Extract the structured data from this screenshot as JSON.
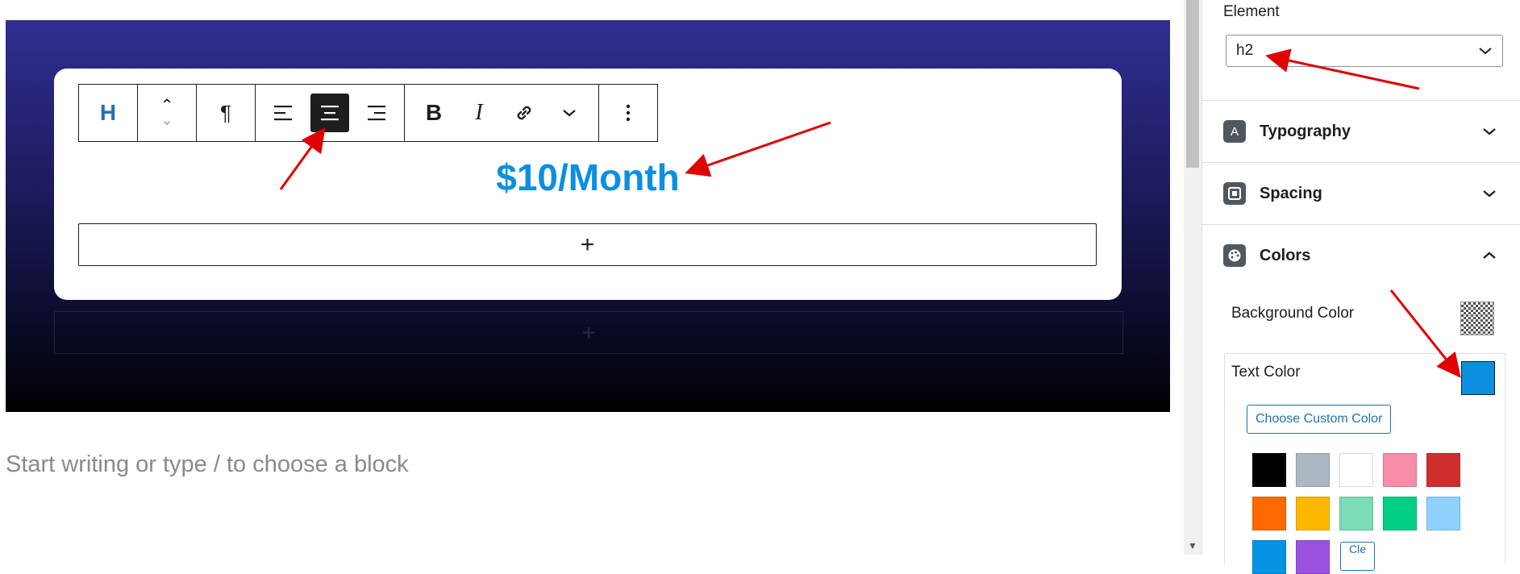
{
  "editor": {
    "toolbar": {
      "heading_label": "H",
      "paragraph_glyph": "¶",
      "bold_label": "B",
      "italic_label": "I"
    },
    "heading_text": "$10/Month",
    "appender_symbol": "+",
    "placeholder": "Start writing or type / to choose a block"
  },
  "sidebar": {
    "element_label": "Element",
    "element_value": "h2",
    "panels": [
      {
        "title": "Typography",
        "icon": "typography-icon",
        "expanded": false
      },
      {
        "title": "Spacing",
        "icon": "spacing-icon",
        "expanded": false
      },
      {
        "title": "Colors",
        "icon": "palette-icon",
        "expanded": true
      }
    ],
    "colors": {
      "background_label": "Background Color",
      "text_label": "Text Color",
      "text_color": "#0b8fe1",
      "custom_button": "Choose Custom Color",
      "clear_button": "Cle",
      "palette": [
        "#000000",
        "#abb8c3",
        "#ffffff",
        "#f78da7",
        "#cf2e2e",
        "#ff6900",
        "#fcb900",
        "#7bdcb5",
        "#00d084",
        "#8ed1fc",
        "#0693e3",
        "#9b51e0"
      ]
    }
  },
  "accent_color": "#e00000"
}
